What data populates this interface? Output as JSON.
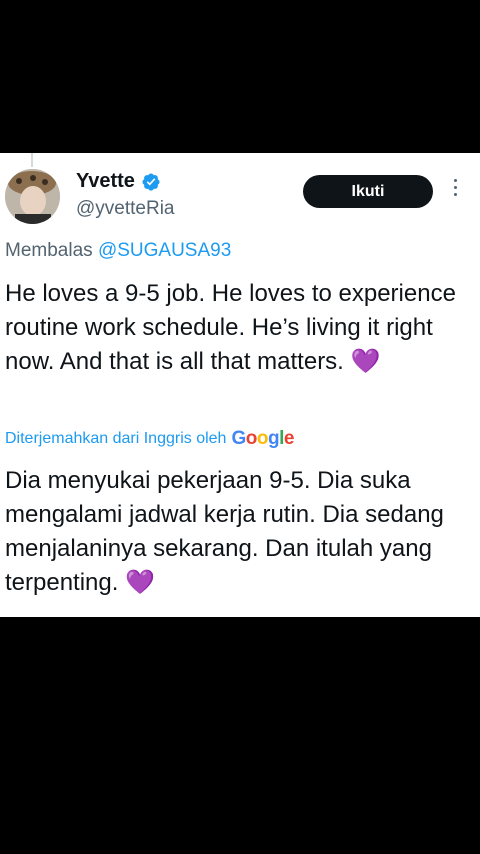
{
  "tweet": {
    "author_name": "Yvette",
    "author_handle": "@yvetteRia",
    "follow_label": "Ikuti",
    "reply_prefix": "Membalas",
    "reply_to": "@SUGAUSA93",
    "text": "He loves a 9-5 job. He loves to experience routine work schedule. He’s living it right now. And that is all that matters.",
    "text_emoji": "💜",
    "translated_by_label": "Diterjemahkan dari Inggris oleh",
    "translation_provider": "Google",
    "translation": "Dia menyukai pekerjaan 9-5. Dia suka mengalami jadwal kerja rutin. Dia sedang menjalaninya sekarang. Dan itulah yang terpenting.",
    "translation_emoji": "💜"
  },
  "colors": {
    "background": "#000000",
    "card": "#ffffff",
    "text": "#0f1419",
    "secondary": "#536471",
    "link": "#1d9bf0",
    "verified": "#1d9bf0",
    "heart": "#8a2be2"
  },
  "icons": {
    "verified": "verified-badge-icon",
    "more": "more-vertical-icon"
  }
}
